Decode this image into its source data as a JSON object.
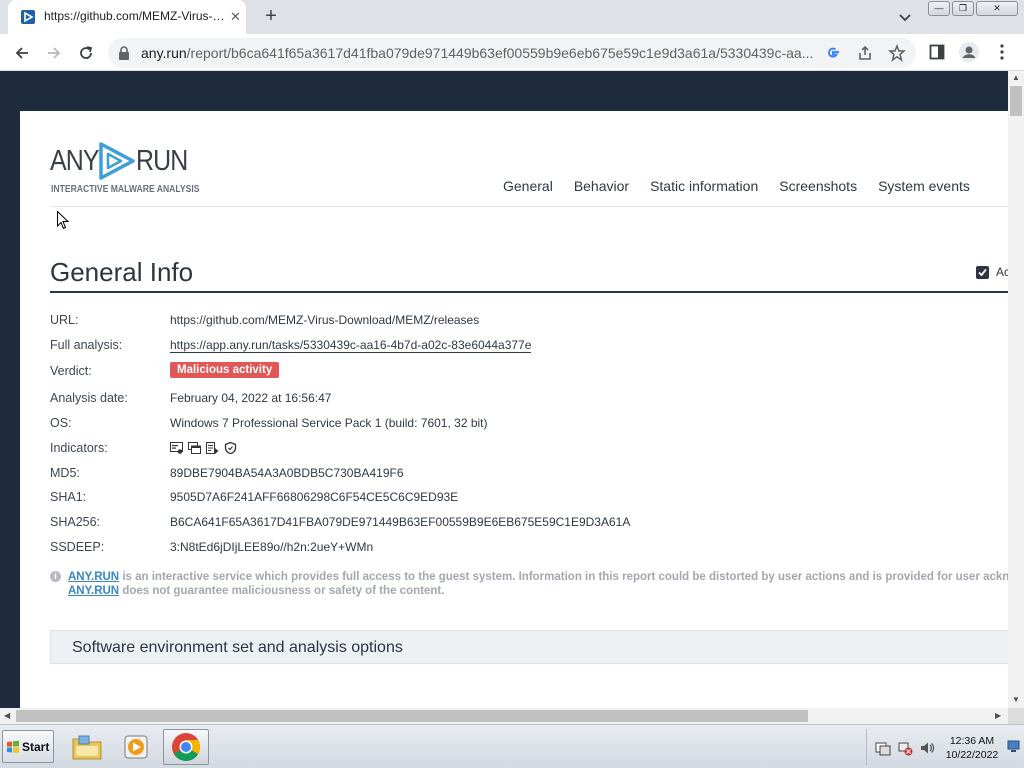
{
  "browser": {
    "tab_title": "https://github.com/MEMZ-Virus-Download",
    "tab_close": "✕",
    "new_tab": "+",
    "url_host": "any.run",
    "url_path": "/report/b6ca641f65a3617d41fba079de971449b63ef00559b9e6eb675e59c1e9d3a61a/5330439c-aa...",
    "window_controls": {
      "minimize": "—",
      "maximize": "❐",
      "close": "✕"
    }
  },
  "site": {
    "logo_left": "ANY",
    "logo_right": "RUN",
    "logo_tagline": "INTERACTIVE MALWARE ANALYSIS",
    "nav": [
      "General",
      "Behavior",
      "Static information",
      "Screenshots",
      "System events"
    ]
  },
  "general_info": {
    "title": "General Info",
    "adv_label": "Ac",
    "rows": {
      "url": {
        "label": "URL:",
        "value": "https://github.com/MEMZ-Virus-Download/MEMZ/releases"
      },
      "full_analysis": {
        "label": "Full analysis:",
        "value": "https://app.any.run/tasks/5330439c-aa16-4b7d-a02c-83e6044a377e"
      },
      "verdict": {
        "label": "Verdict:",
        "value": "Malicious activity"
      },
      "analysis_date": {
        "label": "Analysis date:",
        "value": "February 04, 2022 at 16:56:47"
      },
      "os": {
        "label": "OS:",
        "value": "Windows 7 Professional Service Pack 1 (build: 7601, 32 bit)"
      },
      "indicators": {
        "label": "Indicators:",
        "icons": [
          "executable-icon",
          "windows-icon",
          "script-icon",
          "shield-icon"
        ]
      },
      "md5": {
        "label": "MD5:",
        "value": "89DBE7904BA54A3A0BDB5C730BA419F6"
      },
      "sha1": {
        "label": "SHA1:",
        "value": "9505D7A6F241AFF66806298C6F54CE5C6C9ED93E"
      },
      "sha256": {
        "label": "SHA256:",
        "value": "B6CA641F65A3617D41FBA079DE971449B63EF00559B9E6EB675E59C1E9D3A61A"
      },
      "ssdeep": {
        "label": "SSDEEP:",
        "value": "3:N8tEd6jDIjLEE89o//h2n:2ueY+WMn"
      }
    },
    "notice": {
      "link1": "ANY.RUN",
      "text1": " is an interactive service which provides full access to the guest system. Information in this report could be distorted by user actions and is provided for user acknowle",
      "link2": "ANY.RUN",
      "text2": " does not guarantee maliciousness or safety of the content."
    },
    "env_section_title": "Software environment set and analysis options"
  },
  "taskbar": {
    "start_label": "Start",
    "time": "12:36 AM",
    "date": "10/22/2022"
  },
  "colors": {
    "page_background": "#1e2a3d",
    "verdict_badge": "#e15757",
    "link_blue": "#3a86c5",
    "logo_accent": "#3e9fd8"
  }
}
